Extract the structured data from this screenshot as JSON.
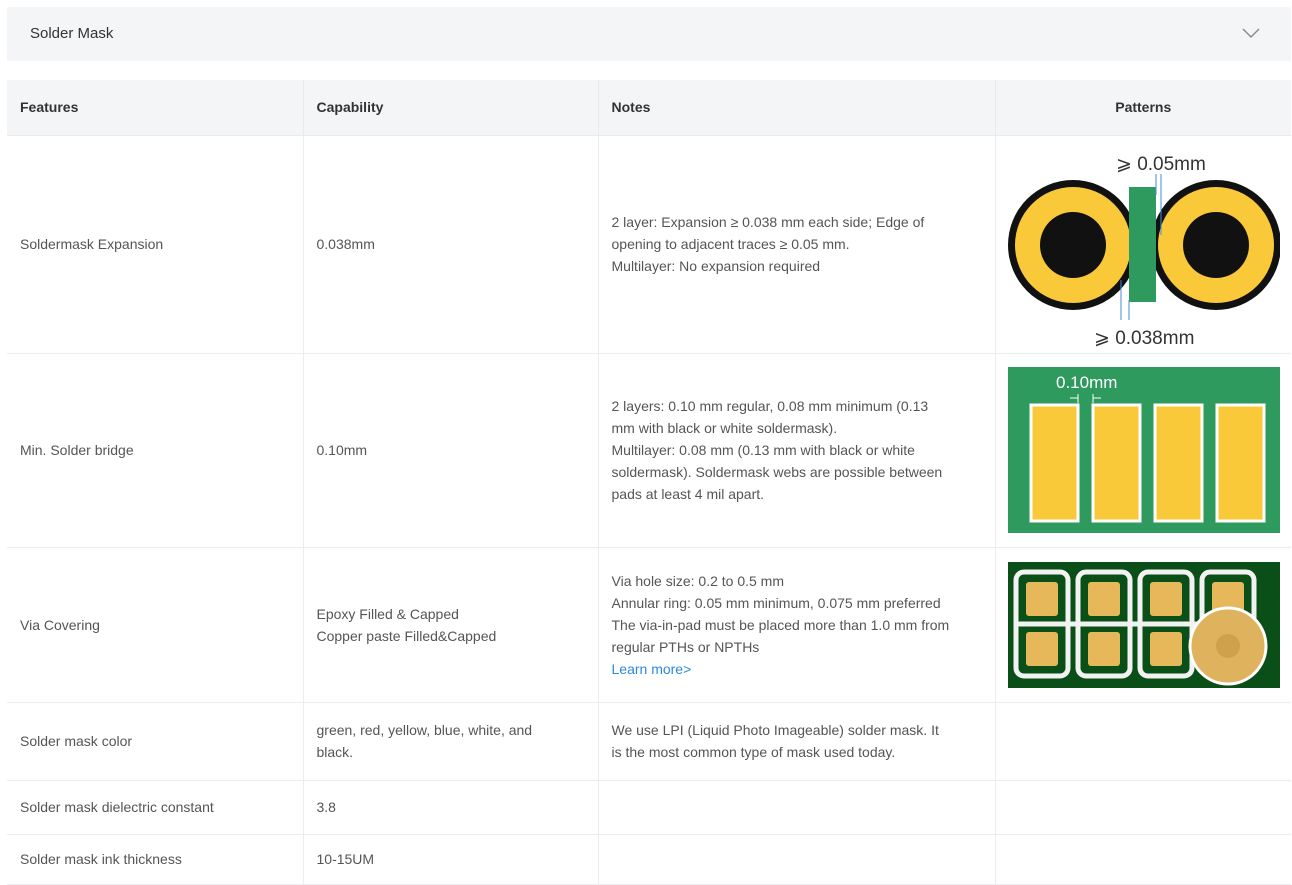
{
  "section": {
    "title": "Solder Mask",
    "chevron_icon": "chevron-down-icon"
  },
  "table": {
    "headers": [
      "Features",
      "Capability",
      "Notes",
      "Patterns"
    ],
    "rows": [
      {
        "feature": "Soldermask Expansion",
        "capability": [
          "0.038mm"
        ],
        "notes": [
          "2 layer: Expansion ≥ 0.038 mm each side; Edge of",
          "opening to adjacent traces ≥ 0.05 mm.",
          "Multilayer: No expansion required"
        ],
        "pattern": {
          "icon": "soldermask-expansion-diagram",
          "label_top": "⩾ 0.05mm",
          "label_bottom": "⩾ 0.038mm"
        }
      },
      {
        "feature": "Min. Solder bridge",
        "capability": [
          "0.10mm"
        ],
        "notes": [
          "2 layers: 0.10 mm regular, 0.08 mm minimum (0.13",
          "mm with black or white soldermask).",
          "Multilayer: 0.08 mm (0.13 mm with black or white",
          "soldermask). Soldermask webs are possible between",
          "pads at least 4 mil apart."
        ],
        "pattern": {
          "icon": "solder-bridge-diagram",
          "label": "0.10mm"
        }
      },
      {
        "feature": "Via Covering",
        "capability": [
          "Epoxy Filled & Capped",
          "Copper paste Filled&Capped"
        ],
        "notes": [
          "Via hole size: 0.2 to 0.5 mm",
          "Annular ring: 0.05 mm minimum, 0.075 mm preferred",
          "The via-in-pad must be placed more than 1.0 mm from",
          "regular PTHs or NPTHs"
        ],
        "link": "Learn more>",
        "pattern": {
          "icon": "via-in-pad-photo"
        }
      },
      {
        "feature": "Solder mask color",
        "capability": [
          "green, red, yellow, blue, white, and",
          "black."
        ],
        "notes": [
          "We use LPI (Liquid Photo Imageable) solder mask. It",
          "is the most common type of mask used today."
        ]
      },
      {
        "feature": "Solder mask dielectric constant",
        "capability": [
          "3.8"
        ],
        "notes": []
      },
      {
        "feature": "Solder mask ink thickness",
        "capability": [
          "10-15UM"
        ],
        "notes": []
      }
    ]
  },
  "colors": {
    "header_bg": "#f4f5f7",
    "link": "#2b89de",
    "pcb_green": "#2f9a5e",
    "pad_yellow": "#fac93a",
    "dark_green": "#0a4f18",
    "dim_blue": "#3d8fd6"
  }
}
